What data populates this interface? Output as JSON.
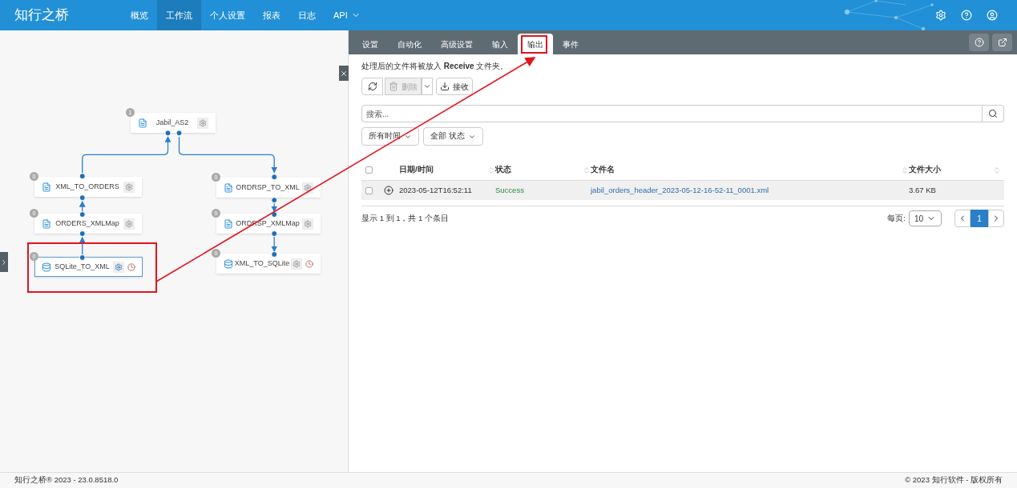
{
  "header": {
    "logo": "知行之桥",
    "nav": [
      {
        "label": "概览",
        "selected": false,
        "dropdown": false
      },
      {
        "label": "工作流",
        "selected": true,
        "dropdown": false
      },
      {
        "label": "个人设置",
        "selected": false,
        "dropdown": false
      },
      {
        "label": "报表",
        "selected": false,
        "dropdown": false
      },
      {
        "label": "日志",
        "selected": false,
        "dropdown": false
      },
      {
        "label": "API",
        "selected": false,
        "dropdown": true
      }
    ]
  },
  "workflow": {
    "nodes": [
      {
        "name": "Jabil_AS2",
        "count": "1",
        "selected": false,
        "scheduled": false
      },
      {
        "name": "XML_TO_ORDERS",
        "count": "0",
        "selected": false,
        "scheduled": false
      },
      {
        "name": "ORDERS_XMLMap",
        "count": "0",
        "selected": false,
        "scheduled": false
      },
      {
        "name": "SQLite_TO_XML",
        "count": "0",
        "selected": true,
        "scheduled": true
      },
      {
        "name": "ORDRSP_TO_XML",
        "count": "0",
        "selected": false,
        "scheduled": false
      },
      {
        "name": "ORDRSP_XMLMap",
        "count": "0",
        "selected": false,
        "scheduled": false
      },
      {
        "name": "XML_TO_SQLite",
        "count": "0",
        "selected": false,
        "scheduled": true
      }
    ]
  },
  "panel": {
    "tabs": [
      {
        "label": "设置",
        "selected": false
      },
      {
        "label": "自动化",
        "selected": false
      },
      {
        "label": "高级设置",
        "selected": false
      },
      {
        "label": "输入",
        "selected": false
      },
      {
        "label": "输出",
        "selected": true
      },
      {
        "label": "事件",
        "selected": false
      }
    ],
    "note": "处理后的文件将被放入 **Receive** 文件夹。",
    "delete_button": {
      "label": "删除",
      "disabled": true
    },
    "receive_button": {
      "label": "接收"
    },
    "search": {
      "placeholder": "搜索..."
    },
    "filters": [
      "所有时间",
      "全部 状态"
    ],
    "table": {
      "select_all_checked": false,
      "columns": [
        "日期/时间",
        "状态",
        "文件名",
        "文件大小"
      ],
      "rows": [
        {
          "checked": false,
          "date": "2023-05-12T16:52:11",
          "status": "Success",
          "file": "jabil_orders_header_2023-05-12-16-52-11_0001.xml",
          "size": "3.67 KB"
        }
      ]
    },
    "summary": "显示 1 到 1，共 1 个条目",
    "per_page_label": "每页:",
    "per_page": "10",
    "pages": [
      {
        "label": "1",
        "selected": true
      }
    ]
  },
  "footer": {
    "left": "知行之桥® 2023 - 23.0.8518.0",
    "right": "© 2023 知行软件 - 版权所有"
  }
}
